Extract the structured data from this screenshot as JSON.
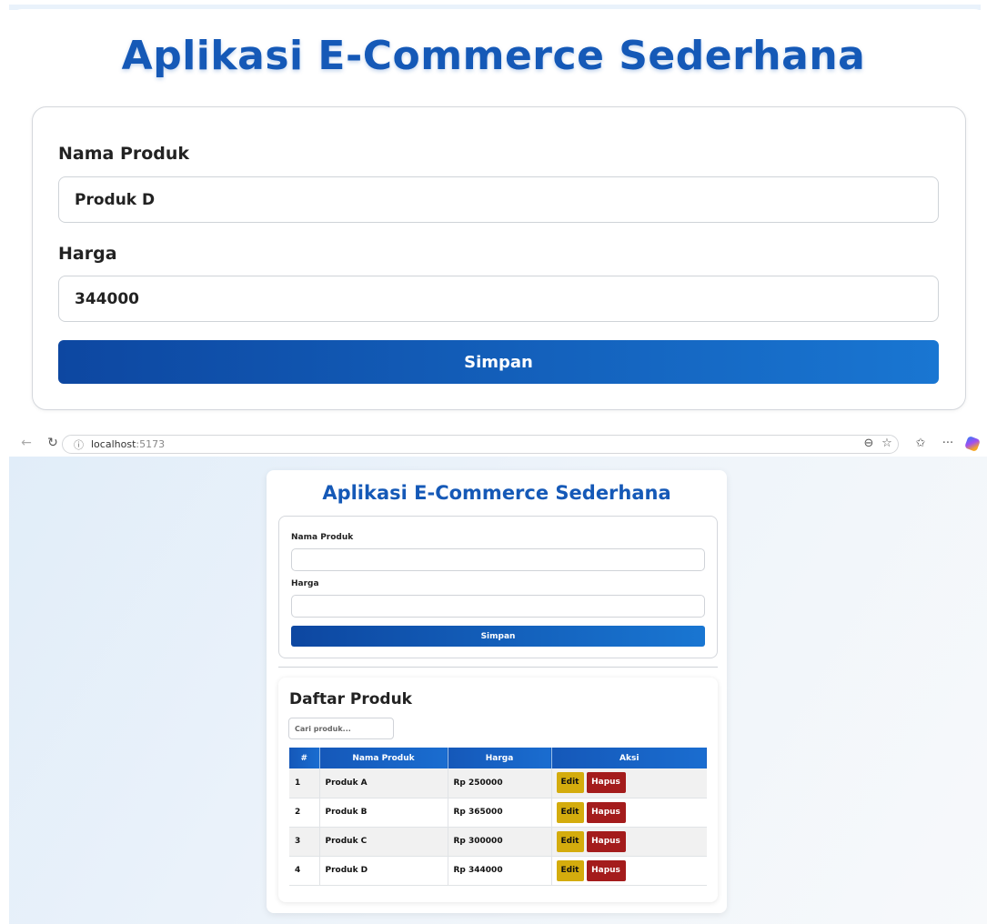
{
  "app": {
    "title": "Aplikasi E-Commerce Sederhana"
  },
  "zoomed_form": {
    "name_label": "Nama Produk",
    "name_value": "Produk D",
    "price_label": "Harga",
    "price_value": "344000",
    "submit_label": "Simpan"
  },
  "browser": {
    "url_host": "localhost",
    "url_port": ":5173"
  },
  "form": {
    "name_label": "Nama Produk",
    "name_value": "",
    "price_label": "Harga",
    "price_value": "",
    "submit_label": "Simpan"
  },
  "product_list": {
    "title": "Daftar Produk",
    "search_placeholder": "Cari produk...",
    "columns": [
      "#",
      "Nama Produk",
      "Harga",
      "Aksi"
    ],
    "edit_label": "Edit",
    "delete_label": "Hapus",
    "rows": [
      {
        "no": "1",
        "name": "Produk A",
        "price": "Rp 250000"
      },
      {
        "no": "2",
        "name": "Produk B",
        "price": "Rp 365000"
      },
      {
        "no": "3",
        "name": "Produk C",
        "price": "Rp 300000"
      },
      {
        "no": "4",
        "name": "Produk D",
        "price": "Rp 344000"
      }
    ]
  },
  "colors": {
    "primary": "#1559b7",
    "button_gradient_start": "#0d47a1",
    "button_gradient_end": "#1976d2",
    "edit_button": "#d4ac0d",
    "delete_button": "#a41c1c"
  },
  "icons": {
    "back": "back-arrow-icon",
    "reload": "reload-icon",
    "site_info": "info-icon",
    "zoom": "zoom-icon",
    "favorite": "star-icon",
    "favorites_list": "favorites-icon",
    "more": "more-icon",
    "copilot": "copilot-icon"
  }
}
